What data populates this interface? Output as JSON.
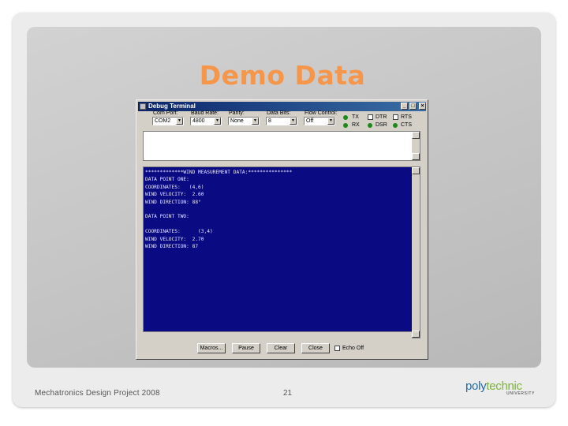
{
  "slide": {
    "title": "Demo Data",
    "footer_left": "Mechatronics Design Project 2008",
    "page_number": "21",
    "title_color": "#f5964a"
  },
  "logo": {
    "part1": "poly",
    "part2": "technic",
    "sub": "UNIVERSITY",
    "colors": {
      "blue": "#1f6ca6",
      "green": "#7db33a"
    }
  },
  "window": {
    "title": "Debug Terminal",
    "title_buttons": [
      "_",
      "□",
      "×"
    ],
    "fields": [
      {
        "label": "Com Port:",
        "value": "COM2"
      },
      {
        "label": "Baud Rate:",
        "value": "4800"
      },
      {
        "label": "Parity:",
        "value": "None"
      },
      {
        "label": "Data Bits:",
        "value": "8"
      },
      {
        "label": "Flow Control:",
        "value": "Off"
      }
    ],
    "signals": {
      "left": [
        "TX",
        "RX"
      ],
      "middle": [
        "DTR",
        "DSR"
      ],
      "right": [
        "RTS",
        "CTS"
      ]
    },
    "receive_lines": [
      "*************WIND MEASUREMENT DATA:***************",
      "DATA POINT ONE:",
      "COORDINATES:   (4,6)",
      "WIND VELOCITY:  2.60",
      "WIND DIRECTION: 88°",
      "",
      "DATA POINT TWO:",
      "",
      "COORDINATES:      (3,4)",
      "WIND VELOCITY:  2.70",
      "WIND DIRECTION: 87"
    ],
    "buttons": {
      "macros": "Macros...",
      "pause": "Pause",
      "clear": "Clear",
      "close": "Close"
    },
    "echo_off_label": "Echo Off",
    "colors": {
      "terminal_bg": "#0a0a82",
      "titlebar": "#0a246a"
    }
  }
}
